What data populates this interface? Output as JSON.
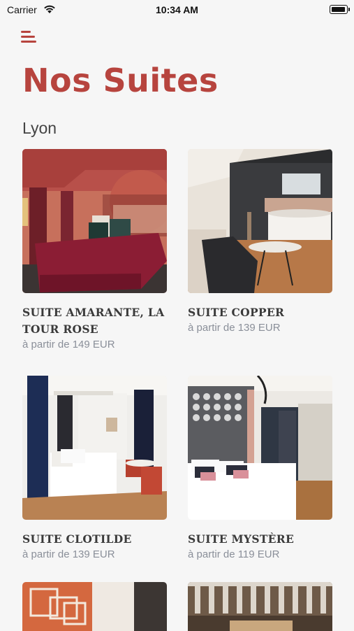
{
  "status_bar": {
    "carrier": "Carrier",
    "time": "10:34 AM"
  },
  "header": {
    "menu_icon": "hamburger-menu-icon",
    "title": "Nos Suites",
    "city": "Lyon"
  },
  "colors": {
    "accent": "#b7443e",
    "price": "#8a8f99",
    "background": "#f6f6f6"
  },
  "suites": [
    {
      "name": "SUITE AMARANTE, LA TOUR ROSE",
      "price": "à partir de 149 EUR"
    },
    {
      "name": "SUITE COPPER",
      "price": "à partir de 139 EUR"
    },
    {
      "name": "SUITE CLOTILDE",
      "price": "à partir de 139 EUR"
    },
    {
      "name": "SUITE MYSTÈRE",
      "price": "à partir de 119 EUR"
    }
  ]
}
